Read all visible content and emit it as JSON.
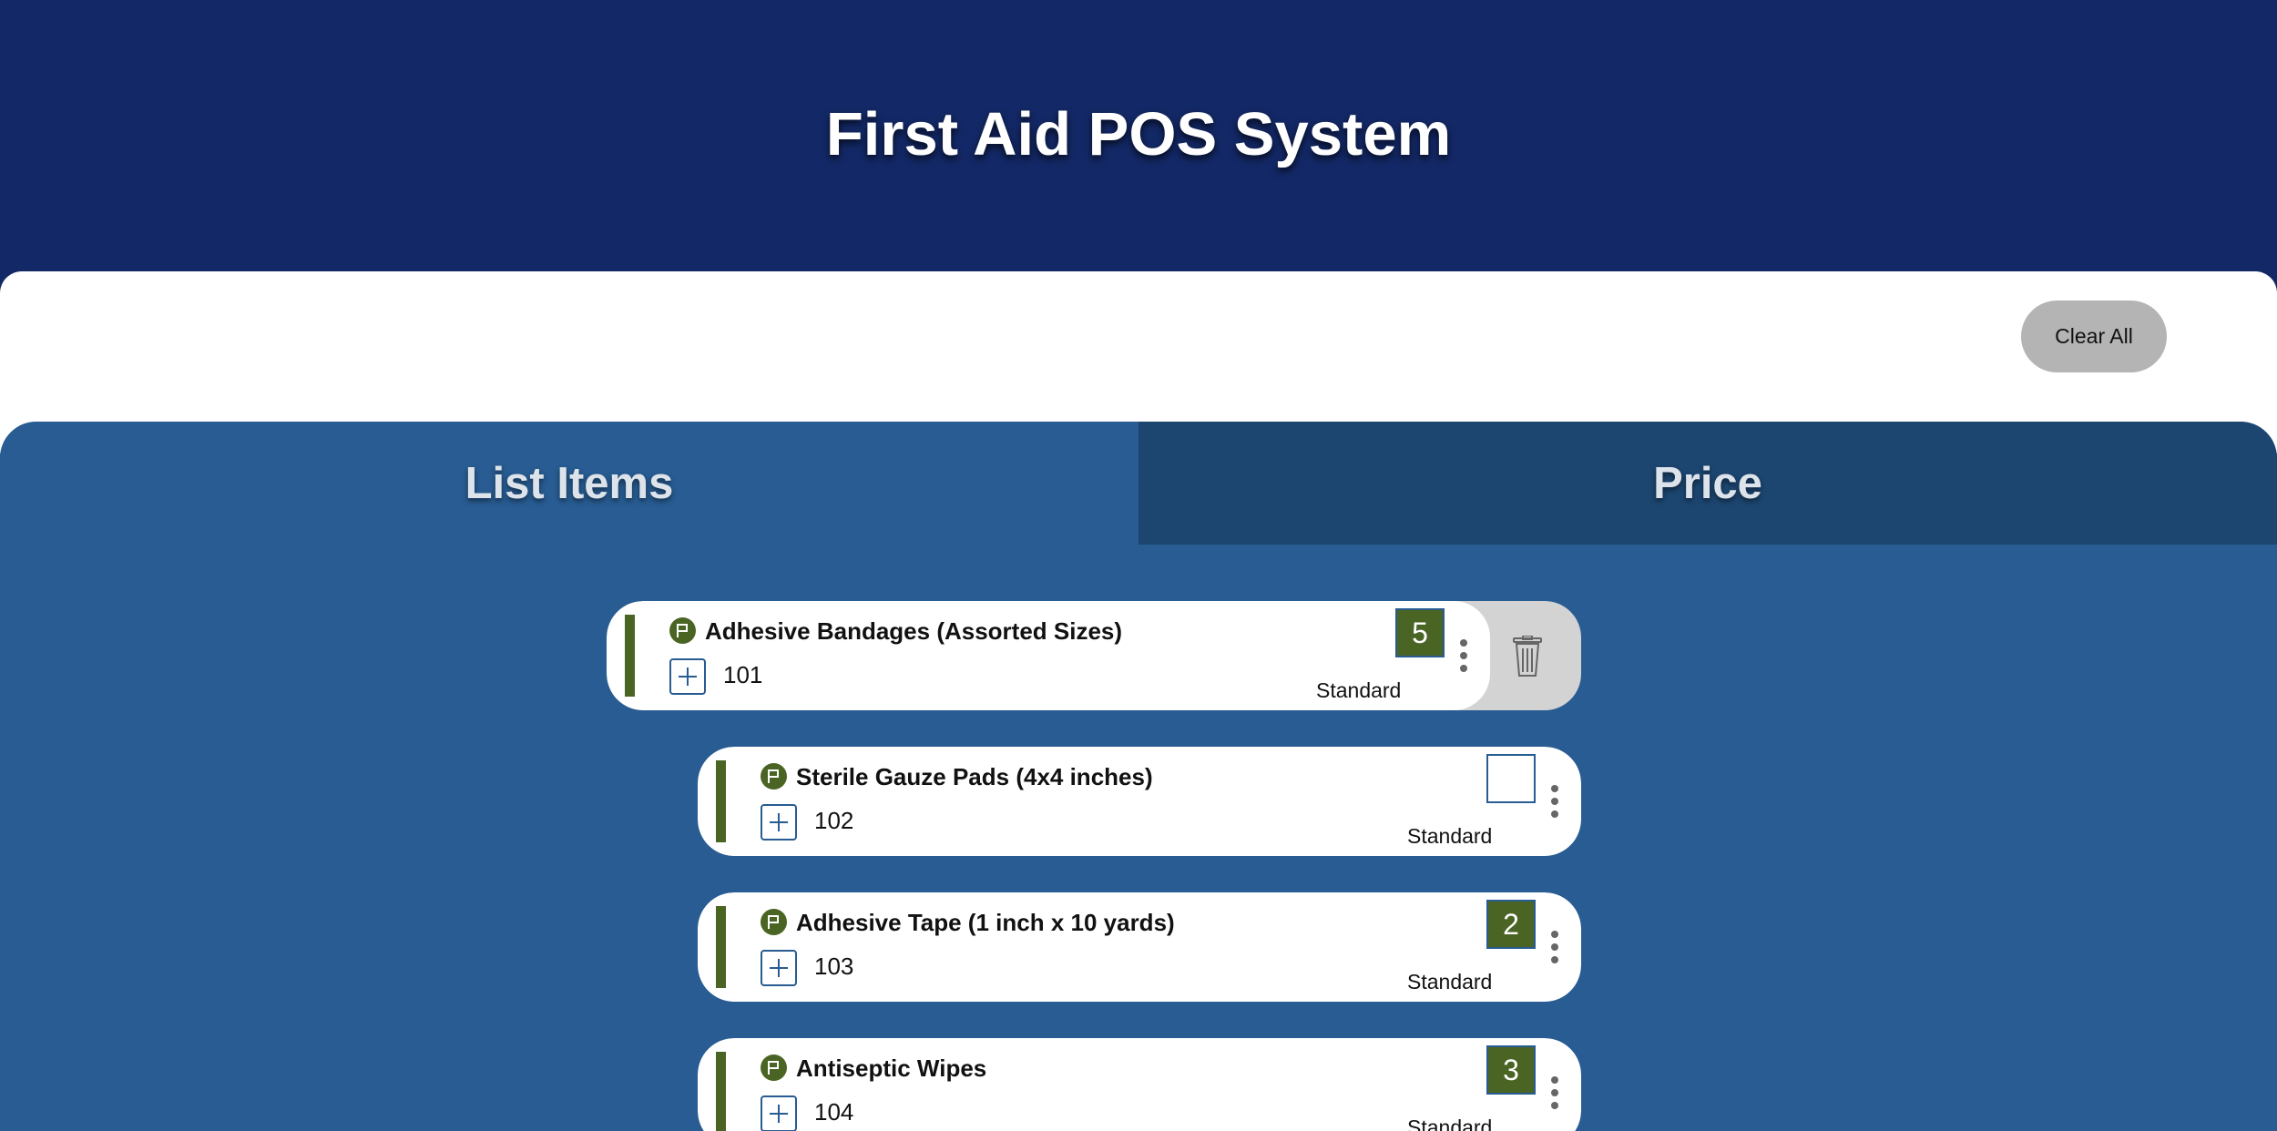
{
  "app": {
    "title": "First Aid POS System"
  },
  "toolbar": {
    "clear_all_label": "Clear All"
  },
  "tabs": [
    {
      "label": "List Items",
      "active": true
    },
    {
      "label": "Price",
      "active": false
    }
  ],
  "items": [
    {
      "name": "Adhesive Bandages (Assorted Sizes)",
      "code": "101",
      "quantity": "5",
      "tag": "Standard",
      "swiped": true
    },
    {
      "name": "Sterile Gauze Pads (4x4 inches)",
      "code": "102",
      "quantity": "",
      "tag": "Standard",
      "swiped": false
    },
    {
      "name": "Adhesive Tape (1 inch x 10 yards)",
      "code": "103",
      "quantity": "2",
      "tag": "Standard",
      "swiped": false
    },
    {
      "name": "Antiseptic Wipes",
      "code": "104",
      "quantity": "3",
      "tag": "Standard",
      "swiped": false
    }
  ],
  "colors": {
    "header": "#132866",
    "panel": "#285c92",
    "inactive_tab": "#1c4670",
    "accent_green": "#4a6424",
    "clear_button": "#b4b4b4"
  },
  "icons": {
    "item_flag": "flag-icon",
    "add": "plus-icon",
    "menu": "more-vertical-icon",
    "delete": "trash-icon"
  }
}
